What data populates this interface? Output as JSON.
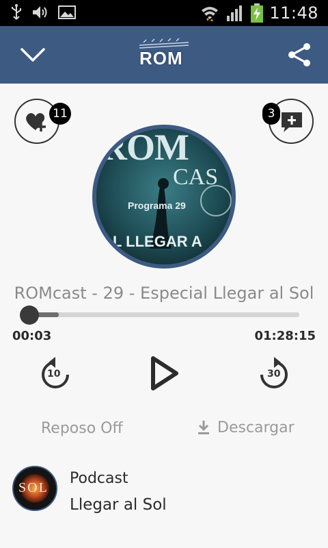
{
  "status_bar": {
    "time": "11:48",
    "icons": [
      "usb-icon",
      "volume-icon",
      "image-icon",
      "wifi-icon",
      "signal-icon",
      "battery-charging-icon"
    ]
  },
  "toolbar": {
    "logo_text": "ROM",
    "back_icon": "chevron-down-icon",
    "share_icon": "share-icon",
    "color": "#3d5a82"
  },
  "actions": {
    "likes_count": "11",
    "comments_count": "3"
  },
  "episode": {
    "title": "ROMcast - 29 - Especial Llegar al Sol",
    "cover_text_1": "ROM",
    "cover_text_2": "CAS",
    "cover_text_3": "Programa 29",
    "cover_text_4": "IAL LLEGAR A"
  },
  "player": {
    "elapsed": "00:03",
    "duration": "01:28:15",
    "progress_fraction": 0.003,
    "buffered_fraction": 0.11,
    "rewind_seconds": "10",
    "forward_seconds": "30"
  },
  "options": {
    "sleep_label": "Reposo Off",
    "download_label": "Descargar"
  },
  "podcast": {
    "label": "Podcast",
    "name": "Llegar al Sol",
    "thumb_text": "SOL"
  }
}
